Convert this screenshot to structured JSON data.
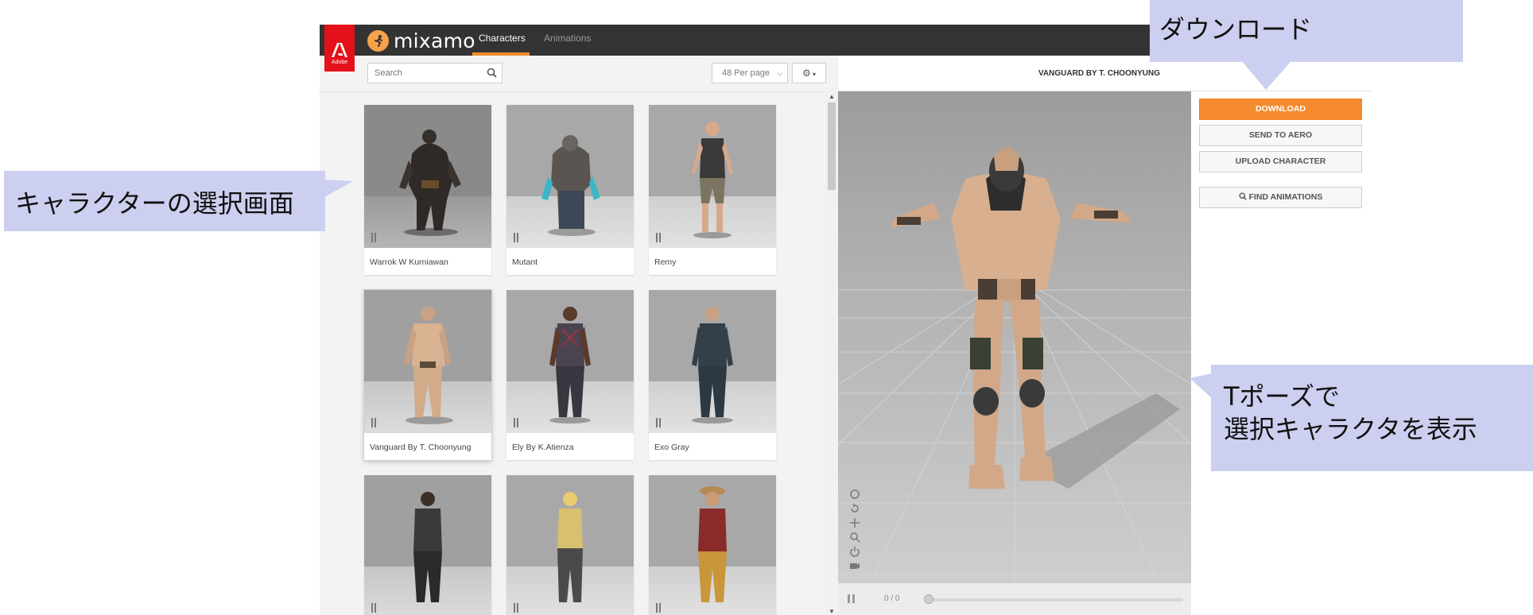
{
  "header": {
    "brand_name": "mixamo",
    "adobe_label": "Adobe",
    "tabs": [
      {
        "label": "Characters",
        "active": true
      },
      {
        "label": "Animations",
        "active": false
      }
    ]
  },
  "toolbar": {
    "search_placeholder": "Search",
    "per_page_value": "48 Per page"
  },
  "characters": [
    {
      "name": "Warrok W Kurniawan",
      "selected": false
    },
    {
      "name": "Mutant",
      "selected": false
    },
    {
      "name": "Remy",
      "selected": false
    },
    {
      "name": "Vanguard By T. Choonyung",
      "selected": true
    },
    {
      "name": "Ely By K.Atienza",
      "selected": false
    },
    {
      "name": "Exo Gray",
      "selected": false
    },
    {
      "name": "",
      "selected": false
    },
    {
      "name": "",
      "selected": false
    },
    {
      "name": "",
      "selected": false
    }
  ],
  "viewer": {
    "title": "VANGUARD BY T. CHOONYUNG",
    "frame_counter": "0 / 0"
  },
  "actions": {
    "download": "DOWNLOAD",
    "send_to_aero": "SEND TO AERO",
    "upload_character": "UPLOAD CHARACTER",
    "find_animations": "FIND ANIMATIONS"
  },
  "annotations": {
    "character_select": "キャラクターの選択画面",
    "download": "ダウンロード",
    "tpose_line1": "Tポーズで",
    "tpose_line2": "選択キャラクタを表示"
  },
  "colors": {
    "accent": "#f58b2e",
    "topbar": "#333333",
    "adobe_red": "#e4111a",
    "callout": "#cccfef"
  }
}
